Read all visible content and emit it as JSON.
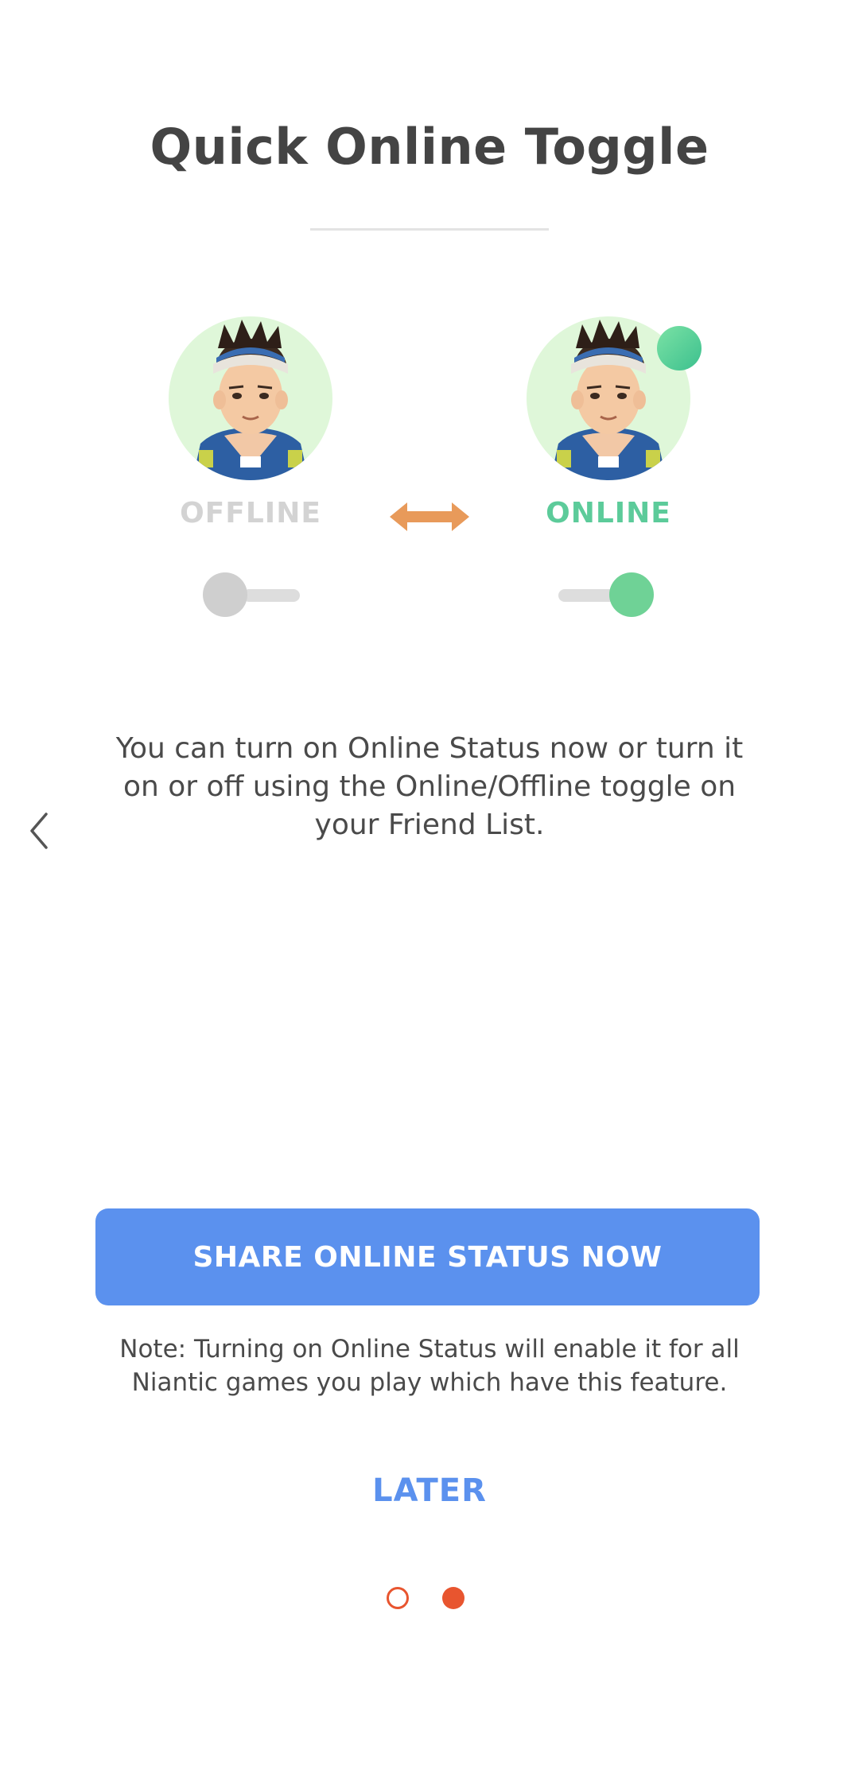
{
  "header": {
    "title": "Quick Online Toggle"
  },
  "status_demo": {
    "offline_label": "OFFLINE",
    "online_label": "ONLINE",
    "offline_toggle_on": false,
    "online_toggle_on": true
  },
  "description": "You can turn on Online Status now or turn it on or off using the Online/Offline toggle on your Friend List.",
  "actions": {
    "primary_label": "SHARE ONLINE STATUS NOW",
    "later_label": "LATER"
  },
  "note": "Note: Turning on Online Status will enable it for all Niantic games you play which have this feature.",
  "pager": {
    "total_pages": 2,
    "current_page": 2
  },
  "icons": {
    "back": "chevron-left-icon",
    "swap": "double-arrow-icon"
  },
  "colors": {
    "accent_blue": "#5b91ee",
    "online_green": "#5ccb9a",
    "offline_gray": "#d3d3d3",
    "arrow_orange": "#e89a5a",
    "pager_orange": "#e8552f",
    "avatar_bg": "#dff7d9"
  }
}
